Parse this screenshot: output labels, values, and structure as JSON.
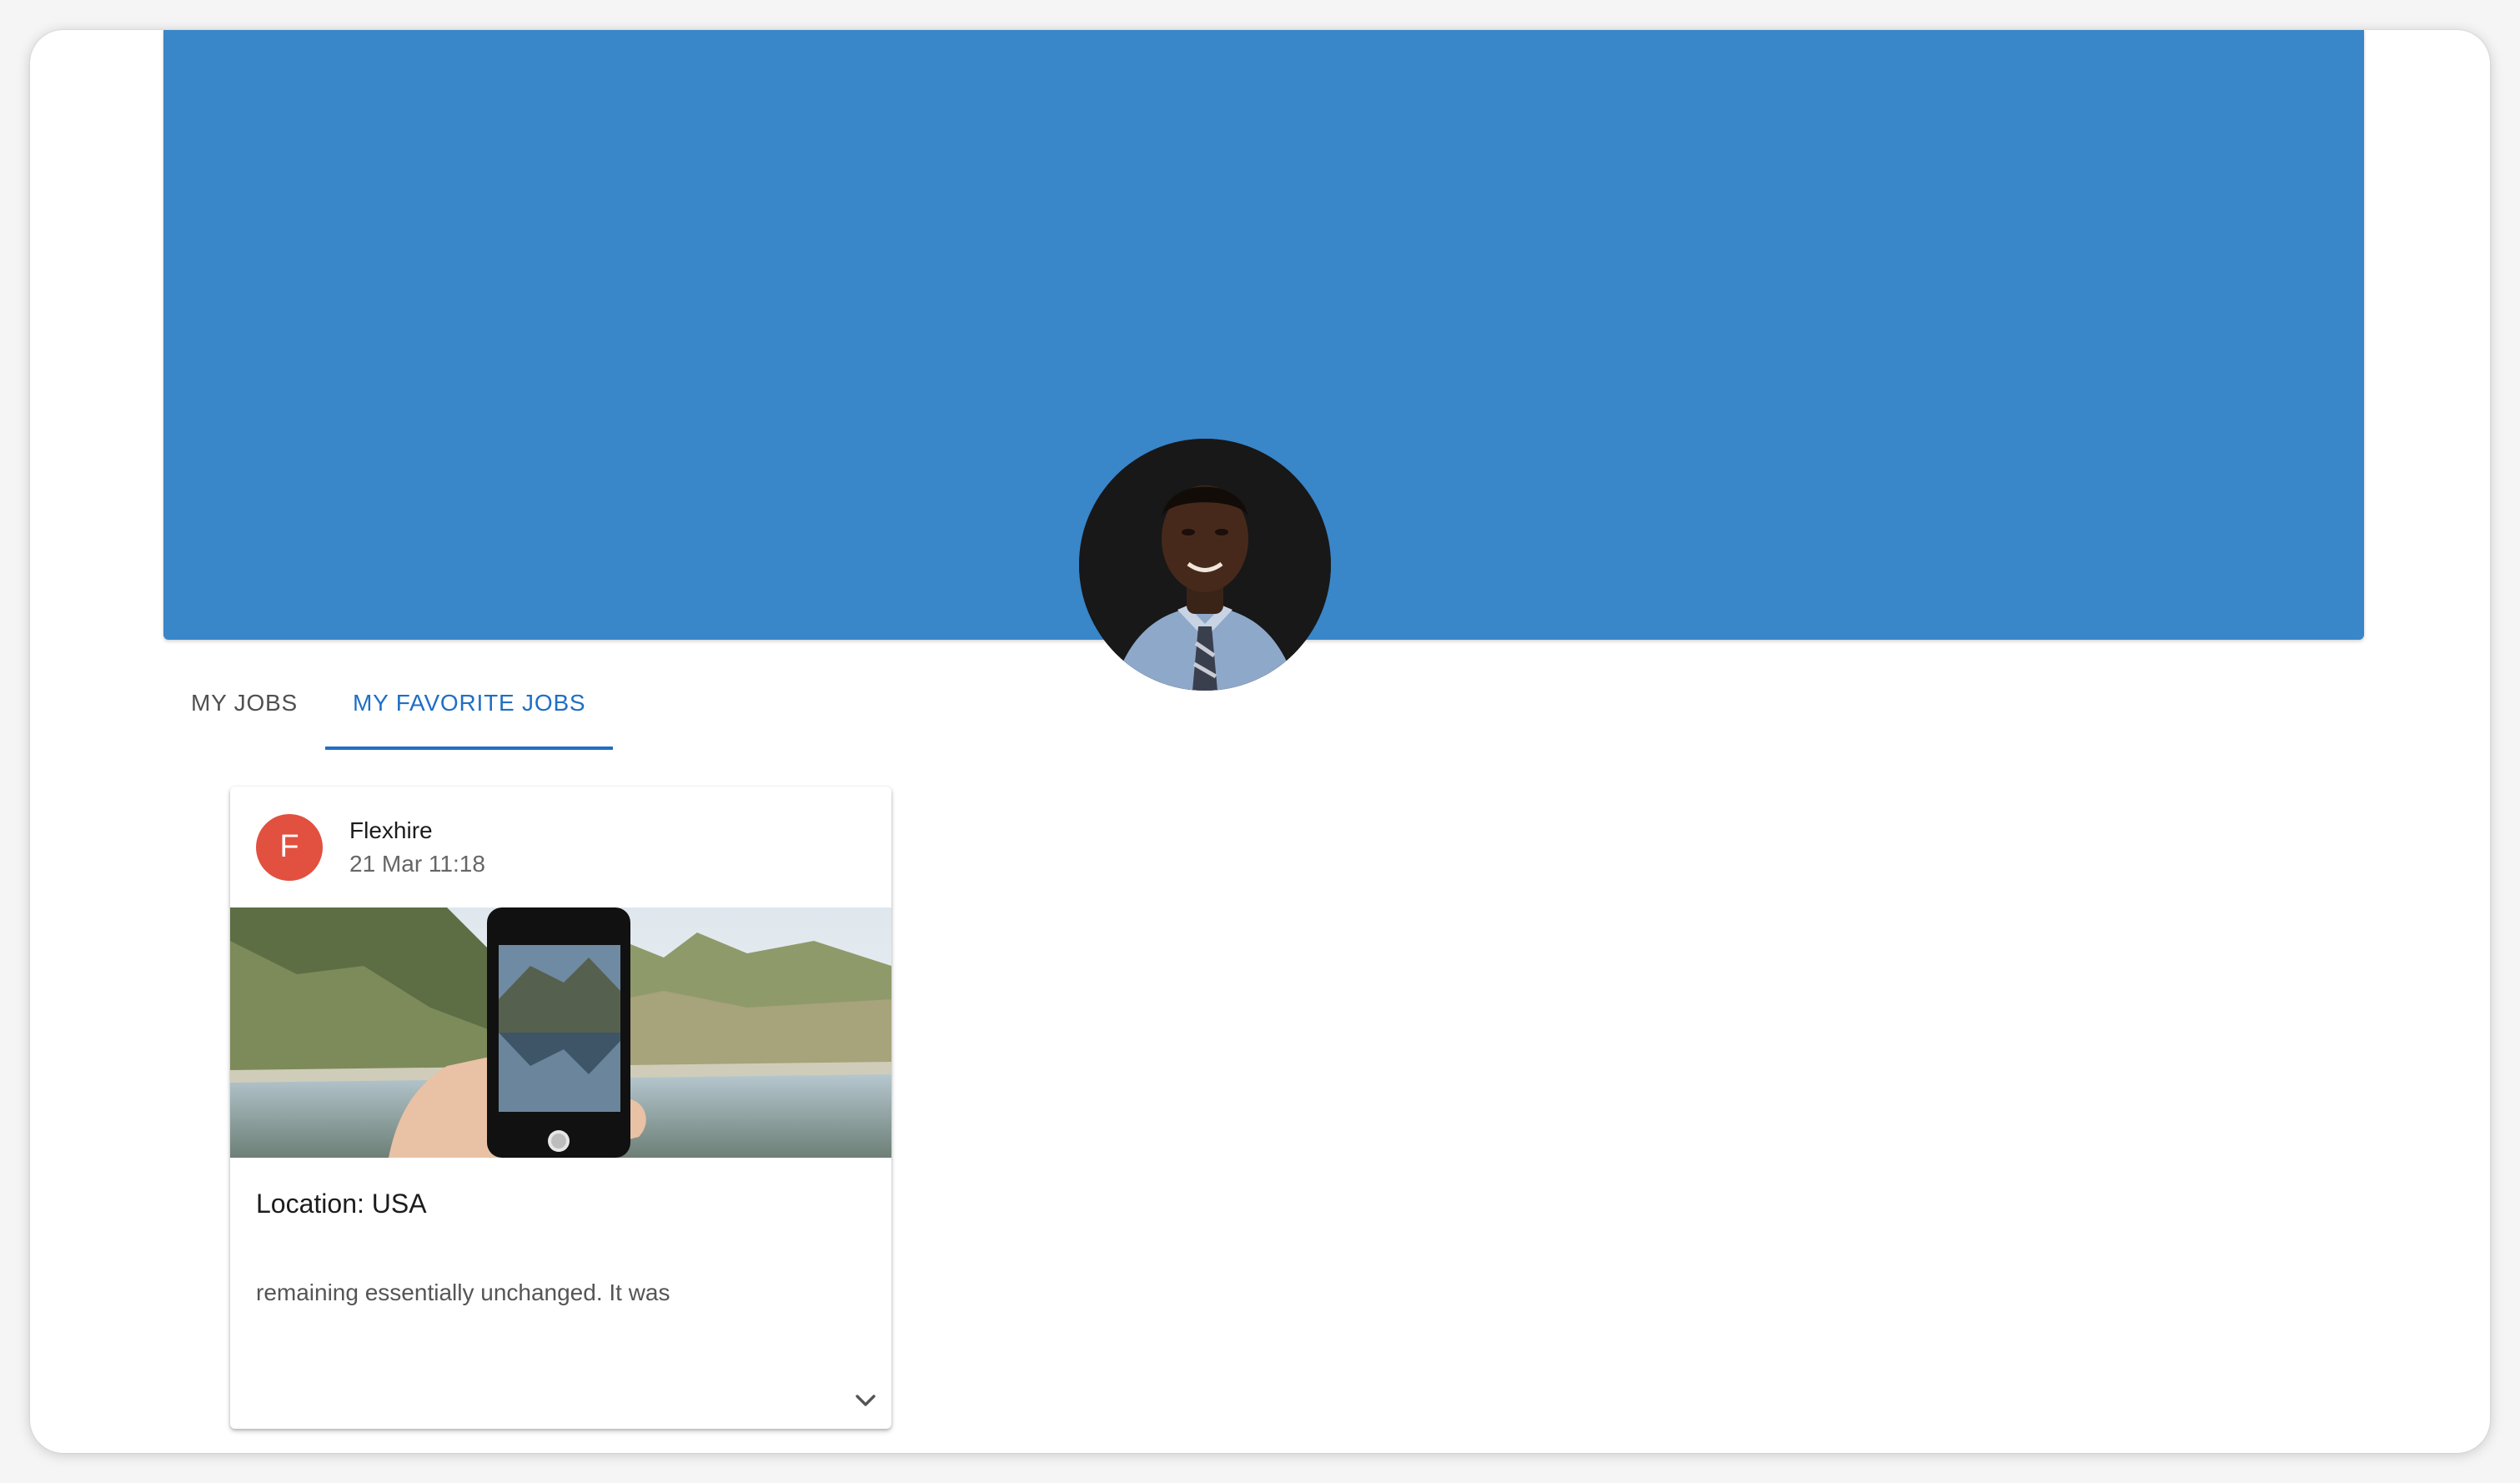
{
  "colors": {
    "banner": "#3986c9",
    "accent": "#1f6fc5",
    "card_avatar_bg": "#e2503f"
  },
  "profile": {
    "avatar_icon": "person-avatar-photo"
  },
  "tabs": [
    {
      "label": "MY JOBS",
      "active": false
    },
    {
      "label": "MY FAVORITE JOBS",
      "active": true
    }
  ],
  "job_card": {
    "avatar_letter": "F",
    "company": "Flexhire",
    "date": "21 Mar 11:18",
    "image_icon": "phone-landscape-photo",
    "location": "Location: USA",
    "description": "remaining essentially unchanged. It was",
    "expand_icon": "chevron-down-icon"
  }
}
